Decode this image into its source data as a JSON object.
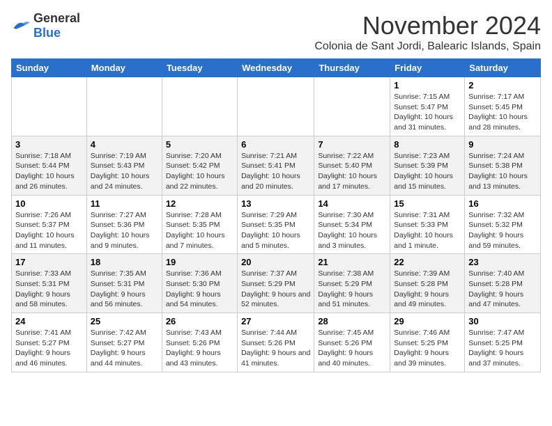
{
  "logo": {
    "text_general": "General",
    "text_blue": "Blue"
  },
  "title": "November 2024",
  "location": "Colonia de Sant Jordi, Balearic Islands, Spain",
  "days_of_week": [
    "Sunday",
    "Monday",
    "Tuesday",
    "Wednesday",
    "Thursday",
    "Friday",
    "Saturday"
  ],
  "weeks": [
    [
      {
        "day": "",
        "info": ""
      },
      {
        "day": "",
        "info": ""
      },
      {
        "day": "",
        "info": ""
      },
      {
        "day": "",
        "info": ""
      },
      {
        "day": "",
        "info": ""
      },
      {
        "day": "1",
        "info": "Sunrise: 7:15 AM\nSunset: 5:47 PM\nDaylight: 10 hours and 31 minutes."
      },
      {
        "day": "2",
        "info": "Sunrise: 7:17 AM\nSunset: 5:45 PM\nDaylight: 10 hours and 28 minutes."
      }
    ],
    [
      {
        "day": "3",
        "info": "Sunrise: 7:18 AM\nSunset: 5:44 PM\nDaylight: 10 hours and 26 minutes."
      },
      {
        "day": "4",
        "info": "Sunrise: 7:19 AM\nSunset: 5:43 PM\nDaylight: 10 hours and 24 minutes."
      },
      {
        "day": "5",
        "info": "Sunrise: 7:20 AM\nSunset: 5:42 PM\nDaylight: 10 hours and 22 minutes."
      },
      {
        "day": "6",
        "info": "Sunrise: 7:21 AM\nSunset: 5:41 PM\nDaylight: 10 hours and 20 minutes."
      },
      {
        "day": "7",
        "info": "Sunrise: 7:22 AM\nSunset: 5:40 PM\nDaylight: 10 hours and 17 minutes."
      },
      {
        "day": "8",
        "info": "Sunrise: 7:23 AM\nSunset: 5:39 PM\nDaylight: 10 hours and 15 minutes."
      },
      {
        "day": "9",
        "info": "Sunrise: 7:24 AM\nSunset: 5:38 PM\nDaylight: 10 hours and 13 minutes."
      }
    ],
    [
      {
        "day": "10",
        "info": "Sunrise: 7:26 AM\nSunset: 5:37 PM\nDaylight: 10 hours and 11 minutes."
      },
      {
        "day": "11",
        "info": "Sunrise: 7:27 AM\nSunset: 5:36 PM\nDaylight: 10 hours and 9 minutes."
      },
      {
        "day": "12",
        "info": "Sunrise: 7:28 AM\nSunset: 5:35 PM\nDaylight: 10 hours and 7 minutes."
      },
      {
        "day": "13",
        "info": "Sunrise: 7:29 AM\nSunset: 5:35 PM\nDaylight: 10 hours and 5 minutes."
      },
      {
        "day": "14",
        "info": "Sunrise: 7:30 AM\nSunset: 5:34 PM\nDaylight: 10 hours and 3 minutes."
      },
      {
        "day": "15",
        "info": "Sunrise: 7:31 AM\nSunset: 5:33 PM\nDaylight: 10 hours and 1 minute."
      },
      {
        "day": "16",
        "info": "Sunrise: 7:32 AM\nSunset: 5:32 PM\nDaylight: 9 hours and 59 minutes."
      }
    ],
    [
      {
        "day": "17",
        "info": "Sunrise: 7:33 AM\nSunset: 5:31 PM\nDaylight: 9 hours and 58 minutes."
      },
      {
        "day": "18",
        "info": "Sunrise: 7:35 AM\nSunset: 5:31 PM\nDaylight: 9 hours and 56 minutes."
      },
      {
        "day": "19",
        "info": "Sunrise: 7:36 AM\nSunset: 5:30 PM\nDaylight: 9 hours and 54 minutes."
      },
      {
        "day": "20",
        "info": "Sunrise: 7:37 AM\nSunset: 5:29 PM\nDaylight: 9 hours and 52 minutes."
      },
      {
        "day": "21",
        "info": "Sunrise: 7:38 AM\nSunset: 5:29 PM\nDaylight: 9 hours and 51 minutes."
      },
      {
        "day": "22",
        "info": "Sunrise: 7:39 AM\nSunset: 5:28 PM\nDaylight: 9 hours and 49 minutes."
      },
      {
        "day": "23",
        "info": "Sunrise: 7:40 AM\nSunset: 5:28 PM\nDaylight: 9 hours and 47 minutes."
      }
    ],
    [
      {
        "day": "24",
        "info": "Sunrise: 7:41 AM\nSunset: 5:27 PM\nDaylight: 9 hours and 46 minutes."
      },
      {
        "day": "25",
        "info": "Sunrise: 7:42 AM\nSunset: 5:27 PM\nDaylight: 9 hours and 44 minutes."
      },
      {
        "day": "26",
        "info": "Sunrise: 7:43 AM\nSunset: 5:26 PM\nDaylight: 9 hours and 43 minutes."
      },
      {
        "day": "27",
        "info": "Sunrise: 7:44 AM\nSunset: 5:26 PM\nDaylight: 9 hours and 41 minutes."
      },
      {
        "day": "28",
        "info": "Sunrise: 7:45 AM\nSunset: 5:26 PM\nDaylight: 9 hours and 40 minutes."
      },
      {
        "day": "29",
        "info": "Sunrise: 7:46 AM\nSunset: 5:25 PM\nDaylight: 9 hours and 39 minutes."
      },
      {
        "day": "30",
        "info": "Sunrise: 7:47 AM\nSunset: 5:25 PM\nDaylight: 9 hours and 37 minutes."
      }
    ]
  ]
}
